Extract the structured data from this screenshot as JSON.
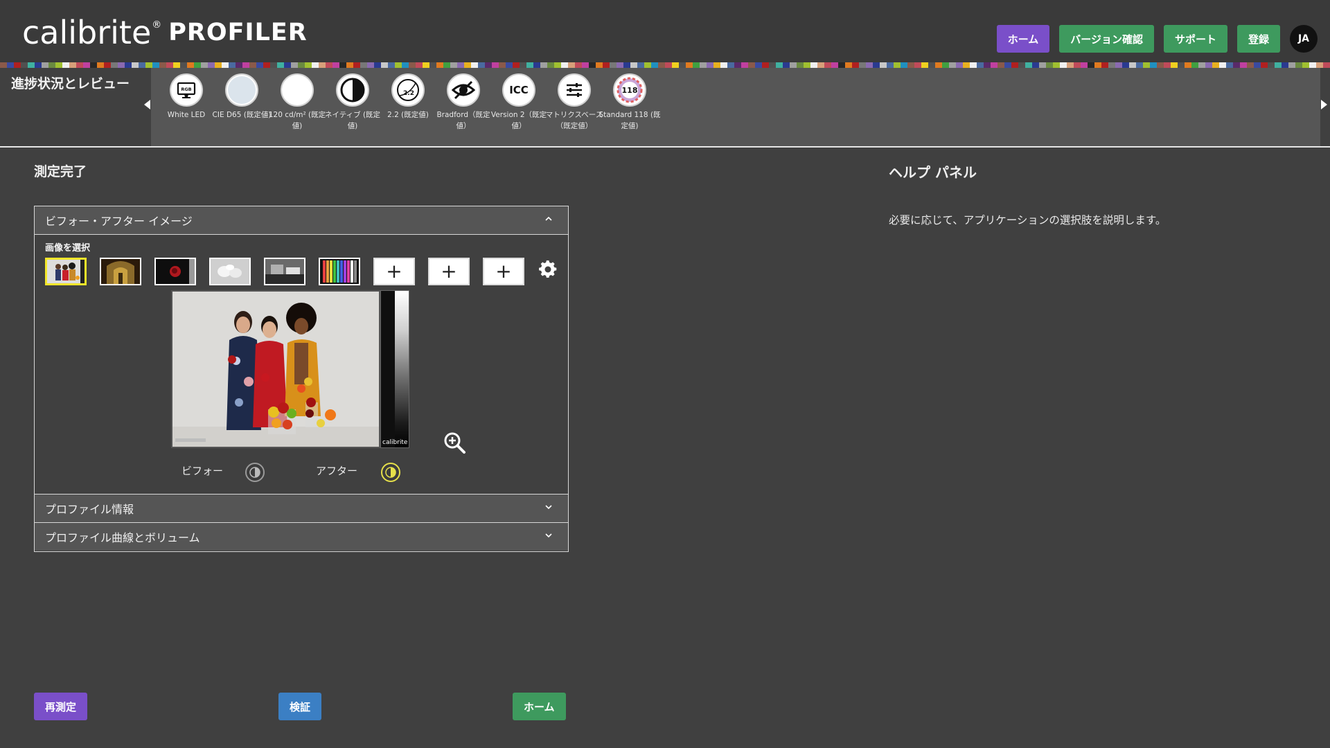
{
  "header": {
    "logo_main": "calibrite",
    "logo_reg": "®",
    "logo_sub": "PROFILER",
    "nav": {
      "home": "ホーム",
      "version_check": "バージョン確認",
      "support": "サポート",
      "register": "登録"
    },
    "avatar": "JA"
  },
  "progress": {
    "title": "進捗状況とレビュー",
    "steps": [
      {
        "label": "White LED",
        "icon": "monitor-rgb-icon"
      },
      {
        "label": "CIE D65 (既定値)",
        "icon": "white-point-icon"
      },
      {
        "label": "120 cd/m² (既定値)",
        "icon": "luminance-icon"
      },
      {
        "label": "ネイティブ (既定値)",
        "icon": "contrast-icon"
      },
      {
        "label": "2.2 (既定値)",
        "icon": "gamma-curve-icon"
      },
      {
        "label": "Bradford（既定値）",
        "icon": "adaptation-eye-icon"
      },
      {
        "label": "Version 2（既定値）",
        "icon": "icc-icon"
      },
      {
        "label": "マトリクスベース（既定値）",
        "icon": "sliders-icon"
      },
      {
        "label": "Standard 118 (既定値)",
        "icon": "patch-set-icon"
      }
    ]
  },
  "main": {
    "title": "測定完了",
    "accordion": {
      "before_after": "ビフォー・アフター イメージ",
      "select_image": "画像を選択",
      "profile_info": "プロファイル情報",
      "profile_curves": "プロファイル曲線とボリューム",
      "before": "ビフォー",
      "after": "アフター",
      "gradient_logo": "calibrite"
    }
  },
  "help": {
    "title": "ヘルプ パネル",
    "text": "必要に応じて、アプリケーションの選択肢を説明します。"
  },
  "buttons": {
    "remeasure": "再測定",
    "verify": "検証",
    "home": "ホーム"
  },
  "colors": {
    "purple": "#7a4fc9",
    "green": "#3e9a5e",
    "blue": "#3b7fc4",
    "selected_border": "#f2e62a"
  }
}
